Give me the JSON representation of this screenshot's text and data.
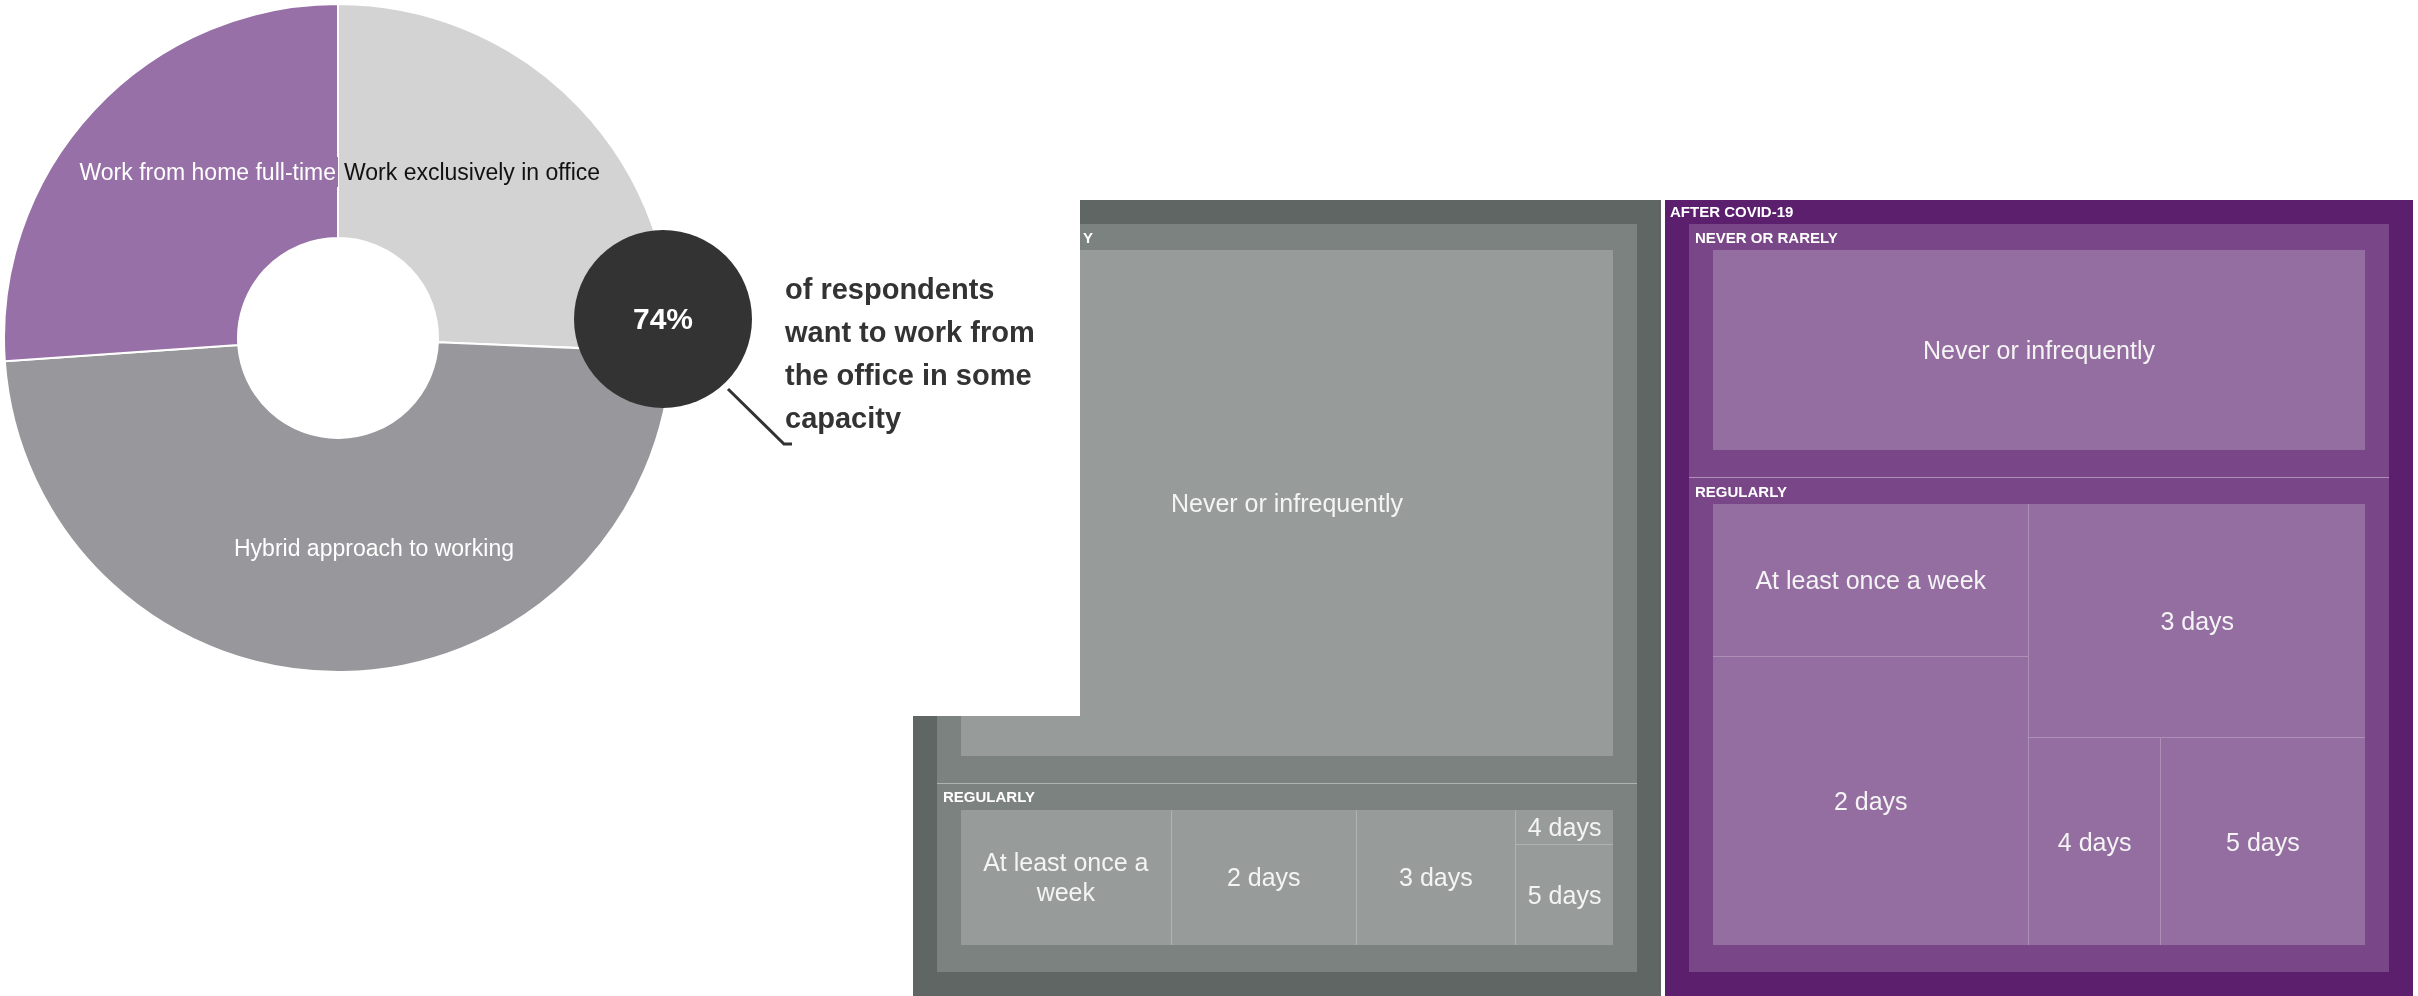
{
  "donut": {
    "slices": [
      {
        "label": "Work exclusively in office",
        "color": "#d3d3d3"
      },
      {
        "label": "Hybrid approach to working",
        "color": "#98979c"
      },
      {
        "label": "Work from home full-time",
        "color": "#9670a6"
      }
    ]
  },
  "callout": {
    "value": "74%",
    "text": "of respondents want to work from the office in some capacity"
  },
  "treemap": {
    "panels": [
      {
        "color": "#5f6664",
        "groups": [
          {
            "label": "Y",
            "leaves": [
              "Never or infrequently"
            ]
          },
          {
            "label": "REGULARLY",
            "leaves": [
              "At least once a week",
              "2 days",
              "3 days",
              "4 days",
              "5 days"
            ]
          }
        ]
      },
      {
        "label": "AFTER COVID-19",
        "color": "#5b1f6e",
        "groups": [
          {
            "label": "NEVER OR RARELY",
            "leaves": [
              "Never or infrequently"
            ]
          },
          {
            "label": "REGULARLY",
            "leaves": [
              "At least once a week",
              "2 days",
              "3 days",
              "4 days",
              "5 days"
            ]
          }
        ]
      }
    ]
  }
}
